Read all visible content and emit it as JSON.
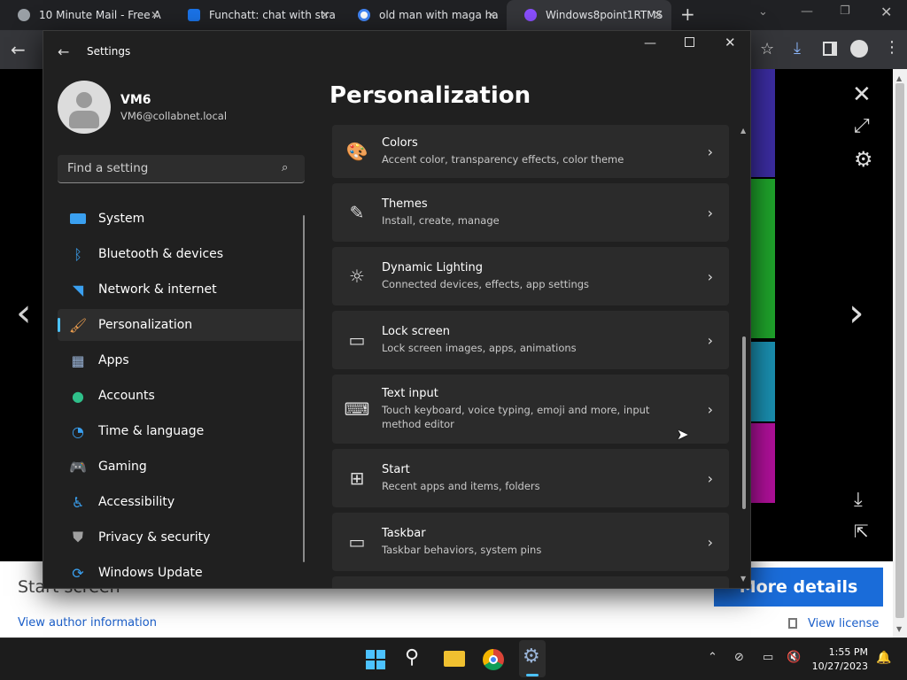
{
  "browser": {
    "tabs": [
      {
        "title": "10 Minute Mail - Free A",
        "favicon_color": "#9aa0a6"
      },
      {
        "title": "Funchatt: chat with stra",
        "favicon_color": "#1a73e8"
      },
      {
        "title": "old man with maga ha",
        "favicon_color": "#4285f4"
      },
      {
        "title": "Windows8point1RTMS",
        "favicon_color": "#8a4fff"
      }
    ],
    "new_tab": "+"
  },
  "webpage": {
    "caption": "Start screen",
    "author_link": "View author information",
    "more_details": "More details",
    "license_link": "View license"
  },
  "settings": {
    "app_title": "Settings",
    "user": {
      "name": "VM6",
      "email": "VM6@collabnet.local"
    },
    "search_placeholder": "Find a setting",
    "page_title": "Personalization",
    "nav": [
      {
        "label": "System",
        "icon": "monitor-icon",
        "color": "#3aa0f0"
      },
      {
        "label": "Bluetooth & devices",
        "icon": "bluetooth-icon",
        "color": "#3aa0f0"
      },
      {
        "label": "Network & internet",
        "icon": "wifi-icon",
        "color": "#3aa0f0"
      },
      {
        "label": "Personalization",
        "icon": "brush-icon",
        "color": "#f0a050"
      },
      {
        "label": "Apps",
        "icon": "apps-icon",
        "color": "#9ab4d8"
      },
      {
        "label": "Accounts",
        "icon": "person-icon",
        "color": "#2fc08a"
      },
      {
        "label": "Time & language",
        "icon": "globe-clock-icon",
        "color": "#3aa0f0"
      },
      {
        "label": "Gaming",
        "icon": "gamepad-icon",
        "color": "#b0b0b0"
      },
      {
        "label": "Accessibility",
        "icon": "accessibility-icon",
        "color": "#3aa0f0"
      },
      {
        "label": "Privacy & security",
        "icon": "shield-icon",
        "color": "#a0a0a0"
      },
      {
        "label": "Windows Update",
        "icon": "update-icon",
        "color": "#3aa0f0"
      }
    ],
    "cards": [
      {
        "title": "Colors",
        "subtitle": "Accent color, transparency effects, color theme",
        "icon": "palette-icon"
      },
      {
        "title": "Themes",
        "subtitle": "Install, create, manage",
        "icon": "brush-icon"
      },
      {
        "title": "Dynamic Lighting",
        "subtitle": "Connected devices, effects, app settings",
        "icon": "lighting-icon"
      },
      {
        "title": "Lock screen",
        "subtitle": "Lock screen images, apps, animations",
        "icon": "lock-screen-icon"
      },
      {
        "title": "Text input",
        "subtitle": "Touch keyboard, voice typing, emoji and more, input method editor",
        "icon": "keyboard-icon"
      },
      {
        "title": "Start",
        "subtitle": "Recent apps and items, folders",
        "icon": "start-icon"
      },
      {
        "title": "Taskbar",
        "subtitle": "Taskbar behaviors, system pins",
        "icon": "taskbar-icon"
      }
    ]
  },
  "taskbar": {
    "time": "1:55 PM",
    "date": "10/27/2023"
  }
}
